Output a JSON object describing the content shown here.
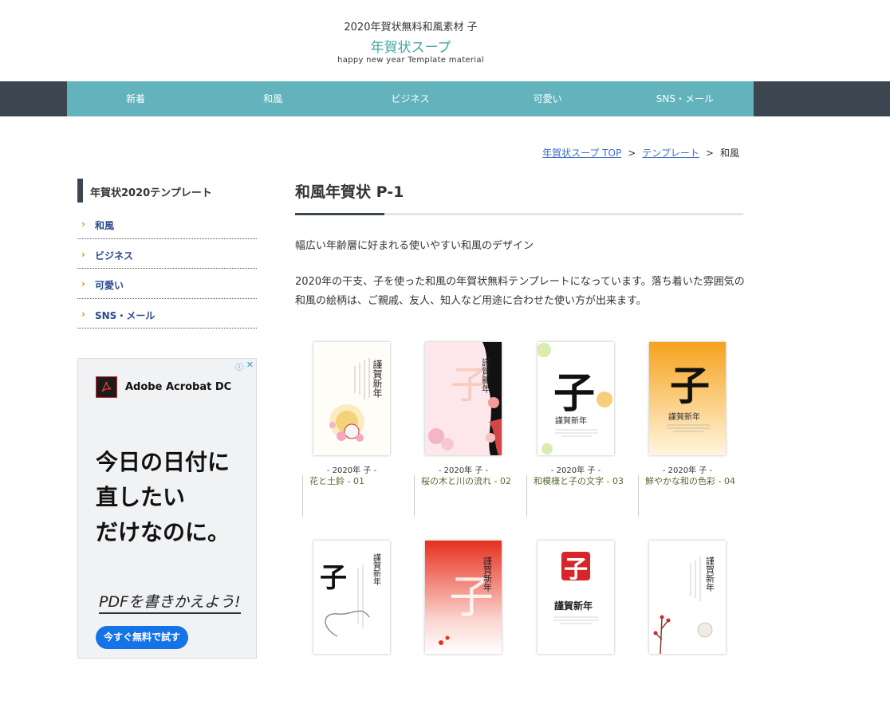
{
  "header": {
    "tagline": "2020年賀状無料和風素材 子",
    "logo": "年賀状スープ",
    "subtitle": "happy new year Template material"
  },
  "nav": [
    "新着",
    "和風",
    "ビジネス",
    "可愛い",
    "SNS・メール"
  ],
  "breadcrumb": {
    "home": "年賀状スープ TOP",
    "section": "テンプレート",
    "current": "和風",
    "separator": ">"
  },
  "sidebar": {
    "title": "年賀状2020テンプレート",
    "chevron": "›",
    "items": [
      "和風",
      "ビジネス",
      "可愛い",
      "SNS・メール"
    ]
  },
  "ad": {
    "brand": "Adobe Acrobat DC",
    "headline_1": "今日の日付に",
    "headline_2": "直したい",
    "headline_3": "だけなのに。",
    "tagline": "PDFを書きかえよう!",
    "cta": "今すぐ無料で試す",
    "info_icon": "ⓘ",
    "close_icon": "✕"
  },
  "main": {
    "title": "和風年賀状 P-1",
    "lead": "幅広い年齢層に好まれる使いやすい和風のデザイン",
    "description": "2020年の干支、子を使った和風の年賀状無料テンプレートになっています。落ち着いた雰囲気の和風の絵柄は、ご親戚、友人、知人など用途に合わせた使い方が出来ます。"
  },
  "cards": [
    {
      "year": "- 2020年 子 -",
      "title": "花と土鈴 - 01",
      "art_text": "謹賀新年"
    },
    {
      "year": "- 2020年 子 -",
      "title": "桜の木と川の流れ - 02",
      "art_text": "謹賀新年"
    },
    {
      "year": "- 2020年 子 -",
      "title": "和模様と子の文字 - 03",
      "art_text": "謹賀新年"
    },
    {
      "year": "- 2020年 子 -",
      "title": "鮮やかな和の色彩 - 04",
      "art_text": "謹賀新年"
    },
    {
      "art_text": "謹賀新年"
    },
    {
      "art_text": "謹賀新年"
    },
    {
      "art_text": "謹賀新年"
    },
    {
      "art_text": "謹賀新年"
    }
  ],
  "art_glyph": "子"
}
